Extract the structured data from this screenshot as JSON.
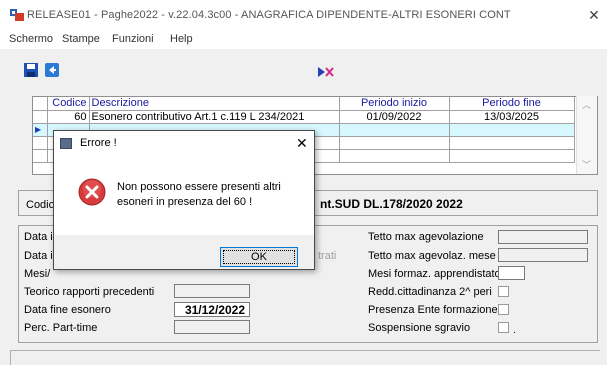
{
  "window": {
    "title": "RELEASE01 - Paghe2022 - v.22.04.3c00 - ANAGRAFICA DIPENDENTE-ALTRI ESONERI CONT",
    "close_glyph": "✕"
  },
  "menu": [
    "Schermo",
    "Stampe",
    "Funzioni",
    "Help"
  ],
  "grid": {
    "columns": [
      "Codice",
      "Descrizione",
      "Periodo inizio",
      "Periodo fine"
    ],
    "rows": [
      {
        "indicator": "",
        "codice": "60",
        "descrizione": "Esonero contributivo Art.1 c.119 L 234/2021",
        "inizio": "01/09/2022",
        "fine": "13/03/2025"
      },
      {
        "indicator": "▶",
        "codice": "",
        "descrizione": "",
        "inizio": "",
        "fine": ""
      },
      {
        "indicator": "",
        "codice": "",
        "descrizione": "",
        "inizio": "",
        "fine": ""
      },
      {
        "indicator": "",
        "codice": "",
        "descrizione": "",
        "inizio": "",
        "fine": ""
      }
    ]
  },
  "codice_section": {
    "label": "Codice",
    "value": "nt.SUD DL.178/2020 2022"
  },
  "form": {
    "left_labels": [
      "Data i",
      "Data i",
      "Mesi/",
      "Teorico rapporti precedenti",
      "Data fine esonero",
      "Perc. Part-time"
    ],
    "data_fine_value": "31/12/2022",
    "faded_text": "trati",
    "right_labels": [
      "Tetto max agevolazione",
      "Tetto max agevolaz. mese",
      "Mesi formaz. apprendistato",
      "Redd.cittadinanza 2^ peri",
      "Presenza Ente formazione",
      "Sospensione sgravio"
    ]
  },
  "dialog": {
    "title": "Errore !",
    "close_glyph": "✕",
    "message_line1": "Non possono essere presenti altri",
    "message_line2": "esoneri in presenza del 60 !",
    "ok_label": "OK"
  }
}
